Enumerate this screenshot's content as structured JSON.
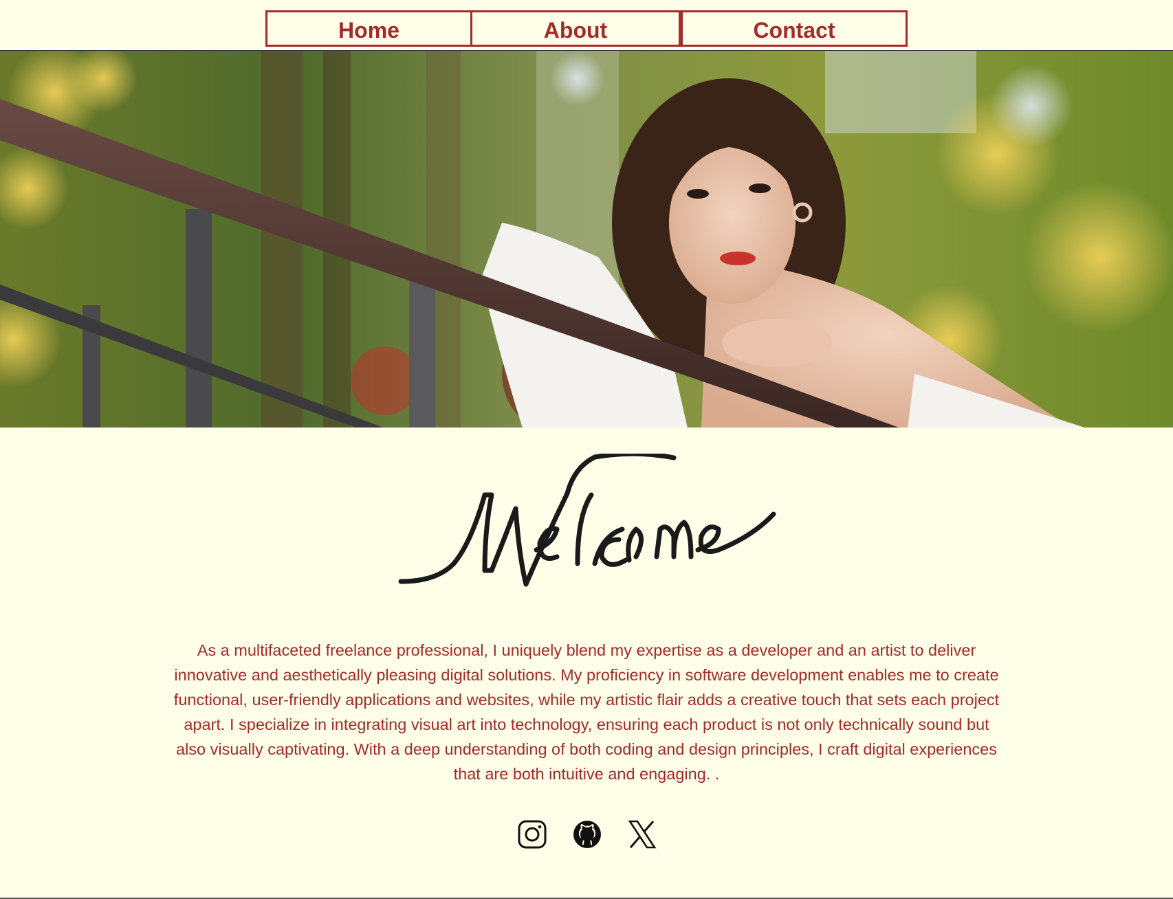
{
  "nav": {
    "items": [
      {
        "label": "Home"
      },
      {
        "label": "About"
      },
      {
        "label": "Contact"
      }
    ]
  },
  "hero": {
    "image": "portrait-photo-woman-leaning-on-railing"
  },
  "welcome": {
    "text": "Welcome"
  },
  "intro": {
    "text": "As a multifaceted freelance professional, I uniquely blend my expertise as a developer and an artist to deliver innovative and aesthetically pleasing digital solutions. My proficiency in software development enables me to create functional, user-friendly applications and websites, while my artistic flair adds a creative touch that sets each project apart. I specialize in integrating visual art into technology, ensuring each product is not only technically sound but also visually captivating. With a deep understanding of both coding and design principles, I craft digital experiences that are both intuitive and engaging. ."
  },
  "social": [
    {
      "icon": "instagram-icon"
    },
    {
      "icon": "github-icon"
    },
    {
      "icon": "x-icon"
    }
  ],
  "colors": {
    "background": "#fefee9",
    "accent": "#a52a2a",
    "text": "#a52a2a"
  }
}
